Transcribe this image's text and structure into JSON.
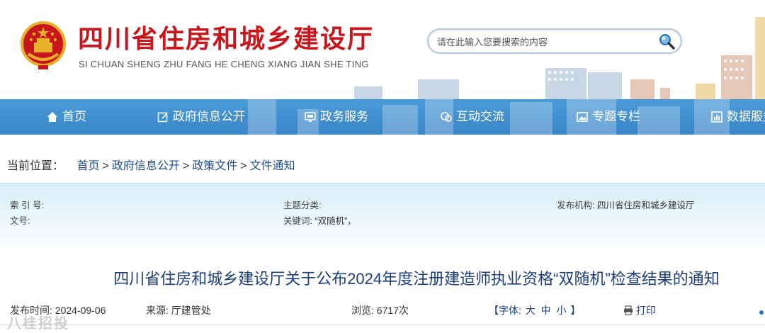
{
  "header": {
    "title": "四川省住房和城乡建设厅",
    "subtitle": "SI CHUAN SHENG ZHU FANG HE CHENG XIANG JIAN SHE TING",
    "search_placeholder": "请在此输入您要搜索的内容"
  },
  "nav": {
    "items": [
      {
        "label": "首页",
        "icon": "home-icon"
      },
      {
        "label": "政府信息公开",
        "icon": "edit-icon"
      },
      {
        "label": "政务服务",
        "icon": "monitor-icon"
      },
      {
        "label": "互动交流",
        "icon": "chat-icon"
      },
      {
        "label": "专题专栏",
        "icon": "image-icon"
      },
      {
        "label": "数据服务",
        "icon": "chart-icon"
      }
    ]
  },
  "breadcrumb": {
    "label": "当前位置：",
    "items": [
      "首页",
      "政府信息公开",
      "政策文件",
      "文件通知"
    ],
    "separator": ">"
  },
  "info": {
    "index_label": "索 引 号:",
    "index_value": "",
    "topic_label": "主题分类:",
    "topic_value": "",
    "publisher_label": "发布机构:",
    "publisher_value": "四川省住房和城乡建设厅",
    "docno_label": "文号:",
    "docno_value": "",
    "keywords_label": "关键词:",
    "keywords_value": "“双随机”，"
  },
  "article": {
    "title": "四川省住房和城乡建设厅关于公布2024年度注册建造师执业资格“双随机”检查结果的通知",
    "publish_label": "发布时间:",
    "publish_date": "2024-09-06",
    "source_label": "来源:",
    "source_value": "厅建管处",
    "views_label": "浏览:",
    "views_value": "6717次",
    "font_label": "【字体:",
    "font_large": "大",
    "font_medium": "中",
    "font_small": "小",
    "font_close": "】",
    "print_label": "打印"
  },
  "watermark": "八桂招投",
  "colors": {
    "title_red": "#c8161d",
    "nav_blue": "#3a86c8",
    "link_blue": "#1d3f78",
    "panel_blue": "#d7eef8"
  }
}
